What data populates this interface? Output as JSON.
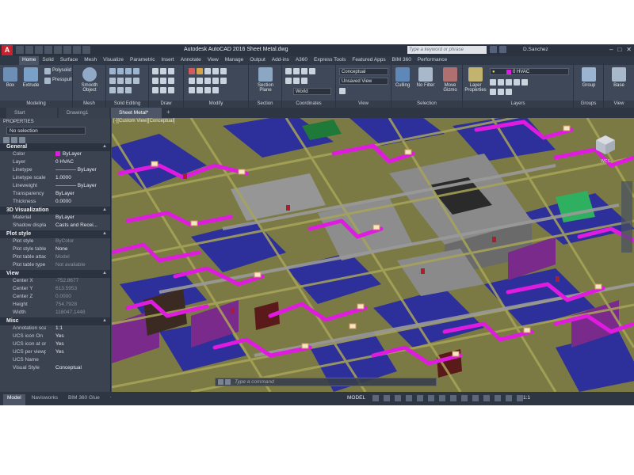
{
  "window": {
    "title": "Autodesk AutoCAD 2016   Sheet Metal.dwg",
    "search_placeholder": "Type a keyword or phrase",
    "user": "D.Sanchez",
    "app_logo": "A"
  },
  "ribbon": {
    "tabs": [
      "Home",
      "Solid",
      "Surface",
      "Mesh",
      "Visualize",
      "Parametric",
      "Insert",
      "Annotate",
      "View",
      "Manage",
      "Output",
      "Add-ins",
      "A360",
      "Express Tools",
      "Featured Apps",
      "BIM 360",
      "Performance"
    ],
    "active_tab": "Home",
    "modeling": {
      "box": "Box",
      "extrude": "Extrude",
      "polysolid": "Polysolid",
      "presspull": "Presspull",
      "label": "Modeling"
    },
    "mesh": {
      "smooth_object": "Smooth Object",
      "label": "Mesh"
    },
    "solid_editing": {
      "label": "Solid Editing"
    },
    "draw": {
      "label": "Draw"
    },
    "modify": {
      "label": "Modify"
    },
    "section": {
      "section_plane": "Section Plane",
      "label": "Section"
    },
    "coordinates": {
      "ucs": "World",
      "label": "Coordinates"
    },
    "view": {
      "visual_style": "Conceptual",
      "saved_view": "Unsaved View",
      "label": "View"
    },
    "selection": {
      "culling": "Culling",
      "no_filter": "No Filter",
      "move_gizmo": "Move Gizmo",
      "label": "Selection"
    },
    "layers": {
      "layer_properties": "Layer Properties",
      "current_layer": "0 HVAC",
      "label": "Layers"
    },
    "groups": {
      "group": "Group",
      "label": "Groups"
    },
    "view2": {
      "base": "Base",
      "label": "View"
    }
  },
  "doc_tabs": [
    "Start",
    "Drawing1",
    "Sheet Metal*"
  ],
  "active_doc_tab": "Sheet Metal*",
  "properties": {
    "title": "PROPERTIES",
    "selection": "No selection",
    "sections": {
      "general": "General",
      "viz3d": "3D Visualization",
      "plot": "Plot style",
      "view": "View",
      "misc": "Misc"
    },
    "general": [
      {
        "name": "Color",
        "value": "ByLayer"
      },
      {
        "name": "Layer",
        "value": "0 HVAC"
      },
      {
        "name": "Linetype",
        "value": "———— ByLayer"
      },
      {
        "name": "Linetype scale",
        "value": "1.0000"
      },
      {
        "name": "Lineweight",
        "value": "———— ByLayer"
      },
      {
        "name": "Transparency",
        "value": "ByLayer"
      },
      {
        "name": "Thickness",
        "value": "0.0000"
      }
    ],
    "viz3d": [
      {
        "name": "Material",
        "value": "ByLayer"
      },
      {
        "name": "Shadow display",
        "value": "Casts and Recei..."
      }
    ],
    "plot": [
      {
        "name": "Plot style",
        "value": "ByColor",
        "dim": true
      },
      {
        "name": "Plot style table",
        "value": "None"
      },
      {
        "name": "Plot table attach...",
        "value": "Model",
        "dim": true
      },
      {
        "name": "Plot table type",
        "value": "Not available",
        "dim": true
      }
    ],
    "view": [
      {
        "name": "Center X",
        "value": "-752.8677",
        "dim": true
      },
      {
        "name": "Center Y",
        "value": "613.5953",
        "dim": true
      },
      {
        "name": "Center Z",
        "value": "0.0000",
        "dim": true
      },
      {
        "name": "Height",
        "value": "754.7928",
        "dim": true
      },
      {
        "name": "Width",
        "value": "118047.1448",
        "dim": true
      }
    ],
    "misc": [
      {
        "name": "Annotation scale",
        "value": "1:1"
      },
      {
        "name": "UCS icon On",
        "value": "Yes"
      },
      {
        "name": "UCS icon at origin",
        "value": "Yes"
      },
      {
        "name": "UCS per viewport",
        "value": "Yes"
      },
      {
        "name": "UCS Name",
        "value": ""
      },
      {
        "name": "Visual Style",
        "value": "Conceptual"
      }
    ]
  },
  "viewport": {
    "label": "[-][Custom View][Conceptual]",
    "command_placeholder": "Type a command",
    "viewcube_label": "WCS"
  },
  "layout_tabs": [
    "Model",
    "Navisworks",
    "BIM 360 Glue"
  ],
  "active_layout_tab": "Model",
  "status": {
    "mode": "MODEL",
    "scale": "1:1"
  },
  "colors": {
    "duct": "#e01be0",
    "slab": "#9c9a2e",
    "floor": "#2d2f9a",
    "wall": "#6f6f6f",
    "accent": "#c8232c"
  }
}
